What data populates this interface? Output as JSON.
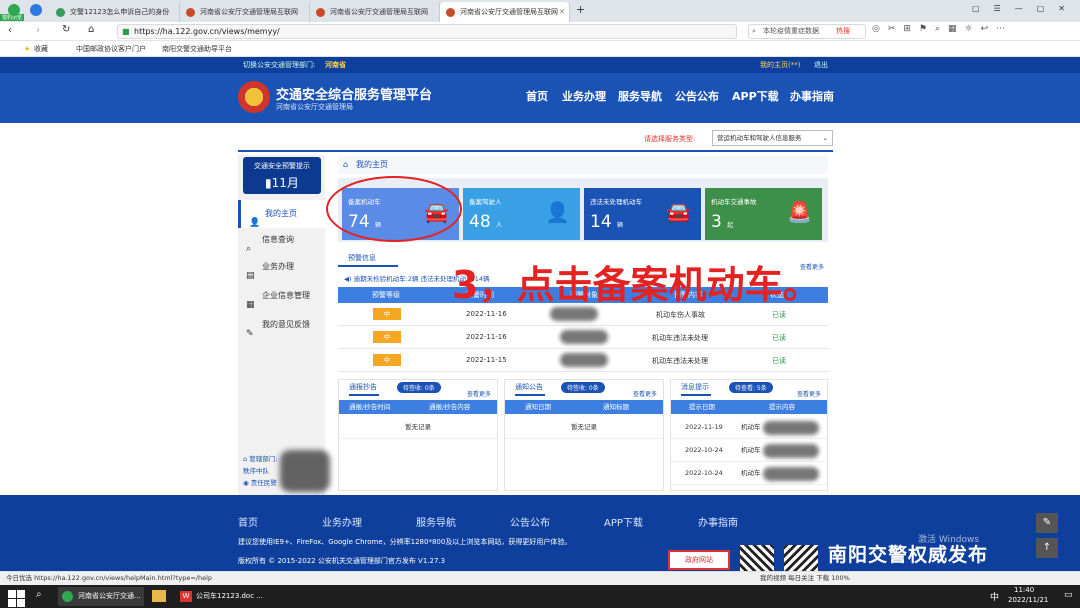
{
  "browser": {
    "tabs": [
      {
        "label": "交警12123怎么申诉自己的身份"
      },
      {
        "label": "河南省公安厅交通管理局互联网"
      },
      {
        "label": "河南省公安厅交通管理局互联网"
      },
      {
        "label": "河南省公安厅交通管理局互联网"
      }
    ],
    "badge": "猎豹浏览",
    "url": "https://ha.122.gov.cn/views/memyy/",
    "search_placeholder": "本轮疫情重症数据",
    "hot_label": "热搜",
    "bookmarks": [
      {
        "label": "收藏"
      },
      {
        "label": "中国邮政协议客户门户"
      },
      {
        "label": "南阳交警交通助导平台"
      }
    ]
  },
  "site": {
    "switch_dept": "切换公安交通管理部门:",
    "province": "河南省",
    "my_home": "我的主页(**)",
    "logout": "退出",
    "title": "交通安全综合服务管理平台",
    "subtitle": "河南省公安厅交通管理局",
    "nav": [
      "首页",
      "业务办理",
      "服务导航",
      "公告公布",
      "APP下载",
      "办事指南"
    ]
  },
  "service": {
    "label": "请选择服务类型:",
    "selected": "营运机动车和驾驶人信息服务"
  },
  "sidebar": {
    "warning_title": "交通安全预警提示",
    "month": "11月",
    "items": [
      {
        "label": "我的主页",
        "icon": "user-icon"
      },
      {
        "label": "信息查询",
        "icon": "search-icon"
      },
      {
        "label": "业务办理",
        "icon": "briefcase-icon"
      },
      {
        "label": "企业信息管理",
        "icon": "doc-icon"
      },
      {
        "label": "我的意见反馈",
        "icon": "edit-icon"
      }
    ],
    "dept_label": "管辖部门:",
    "dept_unit": "秩序中队",
    "owner_label": "责任民警"
  },
  "home": {
    "heading": "我的主页"
  },
  "cards": [
    {
      "label": "备案机动车",
      "value": "74",
      "unit": "辆",
      "color": "#5a8be6"
    },
    {
      "label": "备案驾驶人",
      "value": "48",
      "unit": "人",
      "color": "#3aa0e6"
    },
    {
      "label": "违法未处理机动车",
      "value": "14",
      "unit": "辆",
      "color": "#1b53b5"
    },
    {
      "label": "机动车交通事故",
      "value": "3",
      "unit": "起",
      "color": "#3d8f4a"
    }
  ],
  "warnings": {
    "tab": "预警信息",
    "scroll": "逾期未检验机动车:2辆   违法未处理机动车:14辆",
    "more": "查看更多",
    "headers": [
      "预警等级",
      "预警时间",
      "预警对象",
      "预警内容",
      "状态"
    ],
    "rows": [
      {
        "level": "中",
        "time": "2022-11-16",
        "content": "机动车伤人事故",
        "status": "已读"
      },
      {
        "level": "中",
        "time": "2022-11-16",
        "content": "机动车违法未处理",
        "status": "已读"
      },
      {
        "level": "中",
        "time": "2022-11-15",
        "content": "机动车违法未处理",
        "status": "已读"
      }
    ]
  },
  "panels": [
    {
      "tab": "通报抄告",
      "badge": "待签收: 0条",
      "more": "查看更多",
      "h1": "通报/抄告时间",
      "h2": "通报/抄告内容",
      "empty": "暂无记录"
    },
    {
      "tab": "通知公告",
      "badge": "待签收: 0条",
      "more": "查看更多",
      "h1": "通知日期",
      "h2": "通知标题",
      "empty": "暂无记录"
    },
    {
      "tab": "消息提示",
      "badge": "待查看: 5条",
      "more": "查看更多",
      "h1": "提示日期",
      "h2": "提示内容",
      "rows": [
        {
          "date": "2022-11-19",
          "text": "机动车"
        },
        {
          "date": "2022-10-24",
          "text": "机动车"
        },
        {
          "date": "2022-10-24",
          "text": "机动车"
        }
      ]
    }
  ],
  "annotation": "3，点击备案机动车。",
  "footer": {
    "nav": [
      "首页",
      "业务办理",
      "服务导航",
      "公告公布",
      "APP下载",
      "办事指南"
    ],
    "note": "建议您使用IE9+、FireFox、Google Chrome，分辨率1280*800及以上浏览本网站，获得更好用户体验。",
    "copyright": "版权所有 © 2015-2022 公安机关交通管理部门官方发布 V1.27.3",
    "gov": "政府网站",
    "watermark": "南阳交警权威发布",
    "activate": "激活 Windows"
  },
  "status": {
    "left": "今日优选  https://ha.122.gov.cn/views/helpMain.html?type=/help",
    "right": "我的视频   每日关注   下载   100%"
  },
  "taskbar": {
    "items": [
      {
        "label": "河南省公安厅交通..."
      },
      {
        "label": "公司车12123.doc ..."
      }
    ],
    "time": "11:40",
    "date": "2022/11/21",
    "ime": "中"
  }
}
